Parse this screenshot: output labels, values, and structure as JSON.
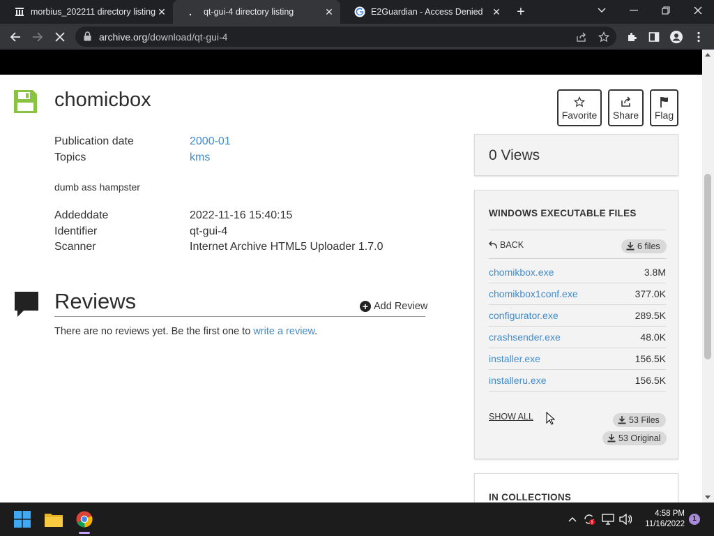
{
  "browser": {
    "tabs": [
      {
        "title": "morbius_202211 directory listing",
        "icon": "archive-icon",
        "active": false
      },
      {
        "title": "qt-gui-4 directory listing",
        "icon": "loading-icon",
        "active": true
      },
      {
        "title": "E2Guardian - Access Denied",
        "icon": "google-icon",
        "active": false
      }
    ],
    "url_host": "archive.org",
    "url_path": "/download/qt-gui-4"
  },
  "item": {
    "title": "chomicbox",
    "actions": {
      "favorite": "Favorite",
      "share": "Share",
      "flag": "Flag"
    },
    "metadata": [
      {
        "label": "Publication date",
        "value": "2000-01",
        "link": true
      },
      {
        "label": "Topics",
        "value": "kms",
        "link": true
      }
    ],
    "description": "dumb ass hampster",
    "details": [
      {
        "label": "Addeddate",
        "value": "2022-11-16 15:40:15"
      },
      {
        "label": "Identifier",
        "value": "qt-gui-4"
      },
      {
        "label": "Scanner",
        "value": "Internet Archive HTML5 Uploader 1.7.0"
      }
    ]
  },
  "reviews": {
    "title": "Reviews",
    "add_label": "Add Review",
    "empty_text": "There are no reviews yet. Be the first one to ",
    "empty_link": "write a review",
    "empty_suffix": "."
  },
  "sidebar": {
    "views": "0 Views",
    "files_panel": {
      "heading": "WINDOWS EXECUTABLE FILES",
      "back_label": "BACK",
      "files_count": "6 files",
      "files": [
        {
          "name": "chomikbox.exe",
          "size": "3.8M"
        },
        {
          "name": "chomikbox1conf.exe",
          "size": "377.0K"
        },
        {
          "name": "configurator.exe",
          "size": "289.5K"
        },
        {
          "name": "crashsender.exe",
          "size": "48.0K"
        },
        {
          "name": "installer.exe",
          "size": "156.5K"
        },
        {
          "name": "installeru.exe",
          "size": "156.5K"
        }
      ],
      "show_all": "SHOW ALL",
      "all_files": "53 Files",
      "all_original": "53 Original"
    },
    "collections_heading": "IN COLLECTIONS"
  },
  "taskbar": {
    "time": "4:58 PM",
    "date": "11/16/2022",
    "notifications": "1"
  },
  "colors": {
    "link": "#428bca",
    "chrome_dark": "#202124",
    "chrome_tab": "#35363a"
  }
}
